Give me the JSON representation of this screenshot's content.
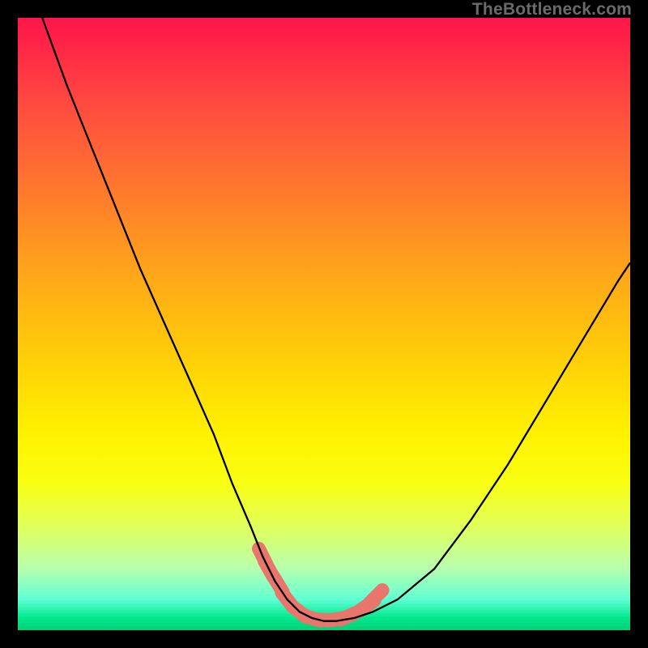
{
  "watermark": "TheBottleneck.com",
  "colors": {
    "marker": "#e9766c",
    "curve": "#000000"
  },
  "chart_data": {
    "type": "line",
    "title": "",
    "xlabel": "",
    "ylabel": "",
    "xlim": [
      0,
      100
    ],
    "ylim": [
      0,
      100
    ],
    "series": [
      {
        "name": "bottleneck-curve",
        "x": [
          4,
          8,
          12,
          16,
          20,
          24,
          28,
          32,
          35,
          38,
          40,
          42,
          44,
          46,
          48,
          50,
          52,
          55,
          58,
          62,
          68,
          74,
          80,
          86,
          92,
          98,
          100
        ],
        "y": [
          100,
          89,
          79,
          69,
          59,
          50,
          41,
          32,
          24,
          17,
          12,
          8,
          5,
          3,
          2,
          1.5,
          1.5,
          2,
          3,
          5,
          10,
          18,
          27,
          37,
          47,
          57,
          60
        ]
      }
    ],
    "flat_region_x": [
      42,
      55
    ],
    "markers": [
      {
        "x": 40,
        "y": 12
      },
      {
        "x": 41,
        "y": 10
      },
      {
        "x": 42.5,
        "y": 7.5
      },
      {
        "x": 44,
        "y": 5
      },
      {
        "x": 46,
        "y": 3
      },
      {
        "x": 48,
        "y": 2
      },
      {
        "x": 50,
        "y": 1.7
      },
      {
        "x": 52,
        "y": 1.8
      },
      {
        "x": 54,
        "y": 2.3
      },
      {
        "x": 57,
        "y": 4
      },
      {
        "x": 58.5,
        "y": 5.5
      }
    ]
  }
}
